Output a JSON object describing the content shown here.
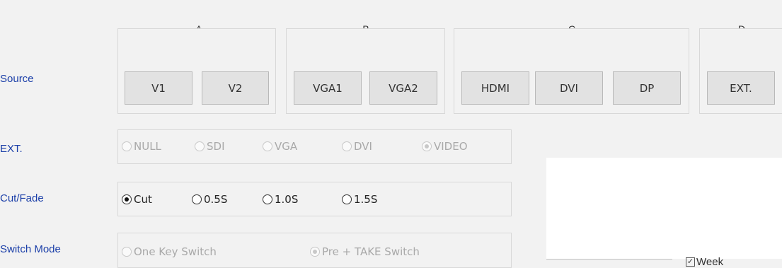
{
  "rows": {
    "source": "Source",
    "ext": "EXT.",
    "cut_fade": "Cut/Fade",
    "switch_mode": "Switch Mode"
  },
  "source_groups": [
    {
      "label": "A",
      "buttons": [
        "V1",
        "V2"
      ]
    },
    {
      "label": "B",
      "buttons": [
        "VGA1",
        "VGA2"
      ]
    },
    {
      "label": "C",
      "buttons": [
        "HDMI",
        "DVI",
        "DP"
      ]
    },
    {
      "label": "D",
      "buttons": [
        "EXT."
      ]
    }
  ],
  "active_indicator_group": "C",
  "indicator_color": "#1212d9",
  "ext_options": [
    "NULL",
    "SDI",
    "VGA",
    "DVI",
    "VIDEO"
  ],
  "ext_selected": "VIDEO",
  "cut_fade_options": [
    "Cut",
    "0.5S",
    "1.0S",
    "1.5S"
  ],
  "cut_fade_selected": "Cut",
  "switch_mode_options": [
    "One Key Switch",
    "Pre + TAKE Switch"
  ],
  "switch_mode_selected": "Pre + TAKE Switch",
  "week_checkbox": {
    "label": "Week",
    "checked": true
  }
}
